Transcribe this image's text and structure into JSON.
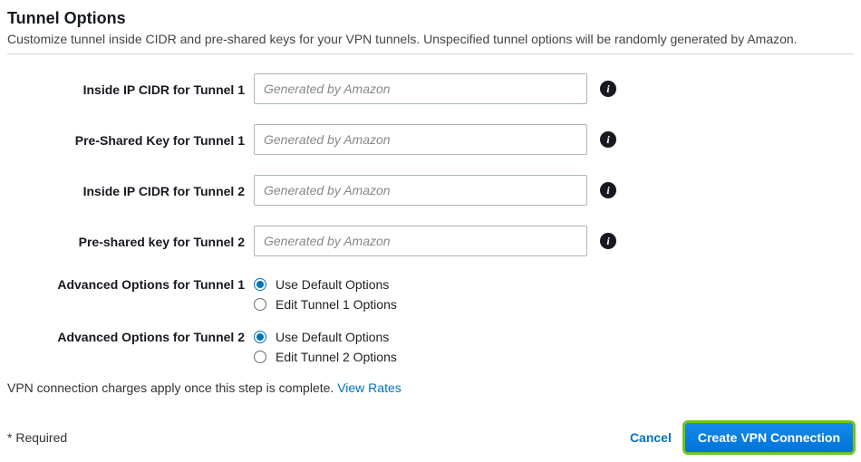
{
  "header": {
    "title": "Tunnel Options",
    "description": "Customize tunnel inside CIDR and pre-shared keys for your VPN tunnels. Unspecified tunnel options will be randomly generated by Amazon."
  },
  "fields": {
    "tunnel1_cidr": {
      "label": "Inside IP CIDR for Tunnel 1",
      "placeholder": "Generated by Amazon",
      "value": ""
    },
    "tunnel1_psk": {
      "label": "Pre-Shared Key for Tunnel 1",
      "placeholder": "Generated by Amazon",
      "value": ""
    },
    "tunnel2_cidr": {
      "label": "Inside IP CIDR for Tunnel 2",
      "placeholder": "Generated by Amazon",
      "value": ""
    },
    "tunnel2_psk": {
      "label": "Pre-shared key for Tunnel 2",
      "placeholder": "Generated by Amazon",
      "value": ""
    }
  },
  "advanced": {
    "tunnel1": {
      "label": "Advanced Options for Tunnel 1",
      "option_default": "Use Default Options",
      "option_edit": "Edit Tunnel 1 Options",
      "selected": "default"
    },
    "tunnel2": {
      "label": "Advanced Options for Tunnel 2",
      "option_default": "Use Default Options",
      "option_edit": "Edit Tunnel 2 Options",
      "selected": "default"
    }
  },
  "notice": {
    "text": "VPN connection charges apply once this step is complete.  ",
    "link": "View Rates"
  },
  "footer": {
    "required": "* Required",
    "cancel": "Cancel",
    "submit": "Create VPN Connection"
  },
  "icons": {
    "info_glyph": "i"
  }
}
